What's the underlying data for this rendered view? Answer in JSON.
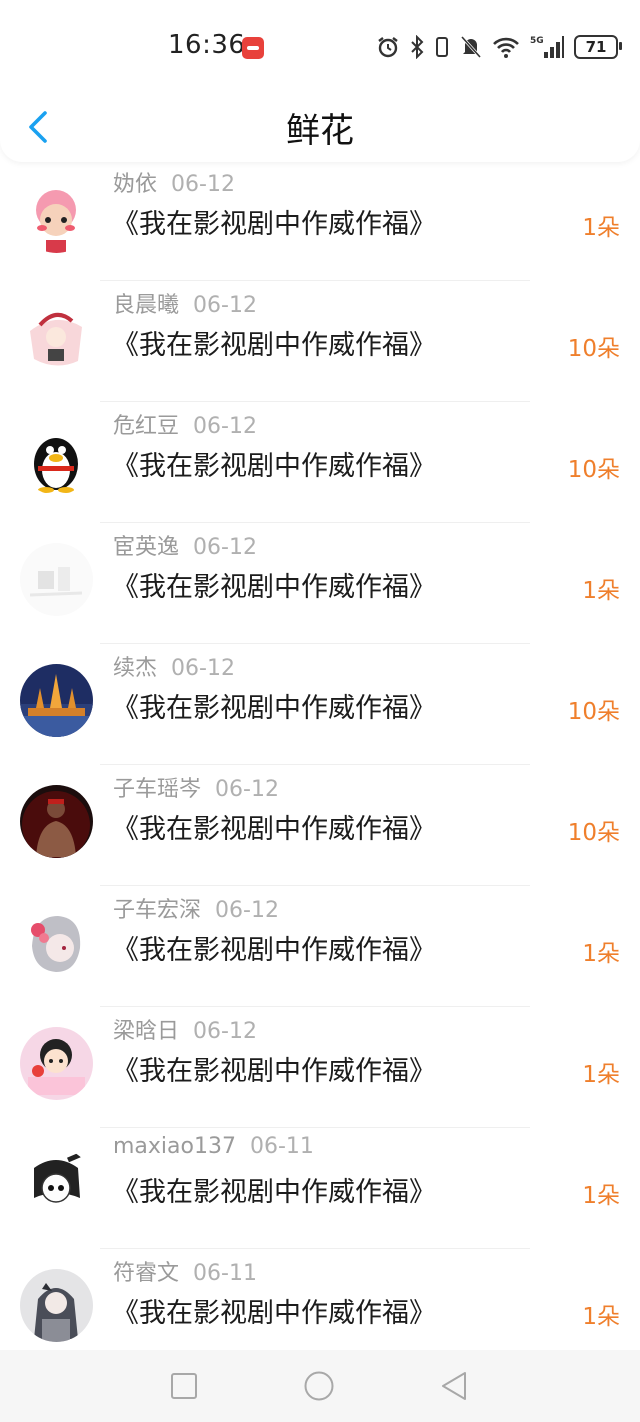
{
  "status_bar": {
    "time": "16:36",
    "network": "5G",
    "battery": "71",
    "icons": [
      "alarm-icon",
      "bluetooth-icon",
      "vibrate-icon",
      "mute-icon",
      "wifi-icon",
      "signal-icon",
      "battery-icon"
    ]
  },
  "header": {
    "title": "鲜花",
    "back_icon": "chevron-left-icon"
  },
  "colors": {
    "accent": "#1aa1f0",
    "count": "#ef7f2c"
  },
  "items": [
    {
      "user": "妫依",
      "date": "06-12",
      "book": "《我在影视剧中作威作福》",
      "count": "1朵",
      "avatar": "pink-hair-cartoon"
    },
    {
      "user": "良晨曦",
      "date": "06-12",
      "book": "《我在影视剧中作威作福》",
      "count": "10朵",
      "avatar": "sketch-girl"
    },
    {
      "user": "危红豆",
      "date": "06-12",
      "book": "《我在影视剧中作威作福》",
      "count": "10朵",
      "avatar": "qq-penguin"
    },
    {
      "user": "宦英逸",
      "date": "06-12",
      "book": "《我在影视剧中作威作福》",
      "count": "1朵",
      "avatar": "faded-sketch"
    },
    {
      "user": "续杰",
      "date": "06-12",
      "book": "《我在影视剧中作威作福》",
      "count": "10朵",
      "avatar": "temple-night"
    },
    {
      "user": "子车瑶岑",
      "date": "06-12",
      "book": "《我在影视剧中作威作福》",
      "count": "10朵",
      "avatar": "man-red"
    },
    {
      "user": "子车宏深",
      "date": "06-12",
      "book": "《我在影视剧中作威作福》",
      "count": "1朵",
      "avatar": "anime-flower-girl"
    },
    {
      "user": "梁晗日",
      "date": "06-12",
      "book": "《我在影视剧中作威作福》",
      "count": "1朵",
      "avatar": "cartoon-pink"
    },
    {
      "user": "maxiao137",
      "date": "06-11",
      "book": "《我在影视剧中作威作福》",
      "count": "1朵",
      "avatar": "manga-girl"
    },
    {
      "user": "符睿文",
      "date": "06-11",
      "book": "《我在影视剧中作威作福》",
      "count": "1朵",
      "avatar": "anime-grey-girl"
    }
  ],
  "nav": [
    "square-icon",
    "circle-icon",
    "triangle-back-icon"
  ]
}
